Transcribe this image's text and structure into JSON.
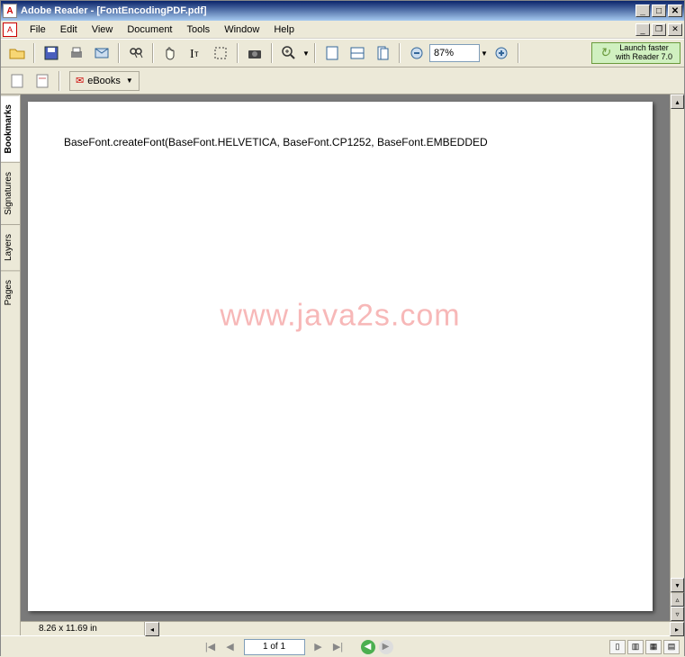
{
  "titlebar": {
    "app_name": "Adobe Reader",
    "document_name": "[FontEncodingPDF.pdf]"
  },
  "menus": {
    "file": "File",
    "edit": "Edit",
    "view": "View",
    "document": "Document",
    "tools": "Tools",
    "window": "Window",
    "help": "Help"
  },
  "toolbar": {
    "zoom_value": "87%",
    "ebooks_label": "eBooks"
  },
  "promo": {
    "line1": "Launch faster",
    "line2": "with Reader 7.0"
  },
  "sidebar_tabs": {
    "bookmarks": "Bookmarks",
    "signatures": "Signatures",
    "layers": "Layers",
    "pages": "Pages"
  },
  "document": {
    "content_line": "BaseFont.createFont(BaseFont.HELVETICA, BaseFont.CP1252, BaseFont.EMBEDDED",
    "watermark": "www.java2s.com"
  },
  "status": {
    "page_dims": "8.26 x 11.69 in",
    "page_info": "1 of 1"
  }
}
